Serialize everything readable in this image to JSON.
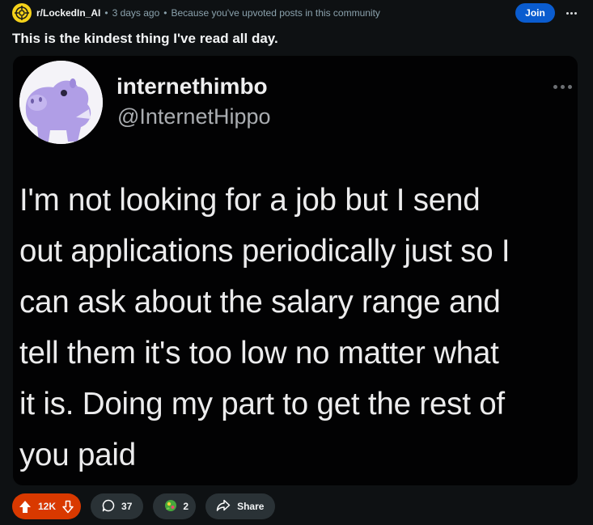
{
  "post": {
    "subreddit": "r/LockedIn_AI",
    "time_ago": "3 days ago",
    "reason": "Because you've upvoted posts in this community",
    "join_label": "Join",
    "title": "This is the kindest thing I've read all day."
  },
  "tweet": {
    "display_name": "internethimbo",
    "handle": "@InternetHippo",
    "lines": [
      "I'm not looking for a job but I send",
      "out applications periodically just so I",
      "can ask about the salary range and",
      "tell them it's too low no matter what",
      "it is. Doing my part to get the rest of",
      "you paid"
    ]
  },
  "actions": {
    "votes": "12K",
    "comments": "37",
    "awards": "2",
    "share_label": "Share"
  },
  "colors": {
    "background": "#0e1113",
    "join": "#0a5ccf",
    "upvoted": "#d93900",
    "pill": "#2a3236",
    "subreddit_icon": "#f5d21a",
    "avatar_hippo": "#b09ee6"
  },
  "icons": {
    "subreddit": "crosshair-icon",
    "upvote": "upvote-arrow-icon",
    "downvote": "downvote-arrow-icon",
    "comment": "speech-bubble-icon",
    "award": "award-icon",
    "share": "share-arrow-icon",
    "more": "ellipsis-icon"
  }
}
